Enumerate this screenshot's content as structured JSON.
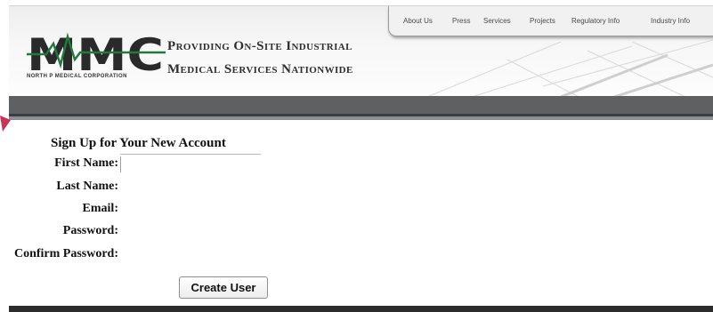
{
  "header": {
    "logo_text": "MMC",
    "logo_subtitle": "NORTH P MEDICAL CORPORATION",
    "tagline_line1": "Providing On-Site Industrial",
    "tagline_line2": "Medical Services Nationwide"
  },
  "nav": {
    "items": [
      "About Us",
      "Press",
      "Services",
      "Projects",
      "Regulatory Info",
      "Industry Info"
    ]
  },
  "form": {
    "title": "Sign Up for Your New Account",
    "fields": [
      {
        "label": "First Name:",
        "value": ""
      },
      {
        "label": "Last Name:",
        "value": ""
      },
      {
        "label": "Email:",
        "value": ""
      },
      {
        "label": "Password:",
        "value": ""
      },
      {
        "label": "Confirm Password:",
        "value": ""
      }
    ],
    "submit_label": "Create User"
  },
  "colors": {
    "header_bar": "#5f6062",
    "accent_bar": "#8a9196",
    "text": "#111111",
    "logo_green": "#1f7a3c"
  }
}
